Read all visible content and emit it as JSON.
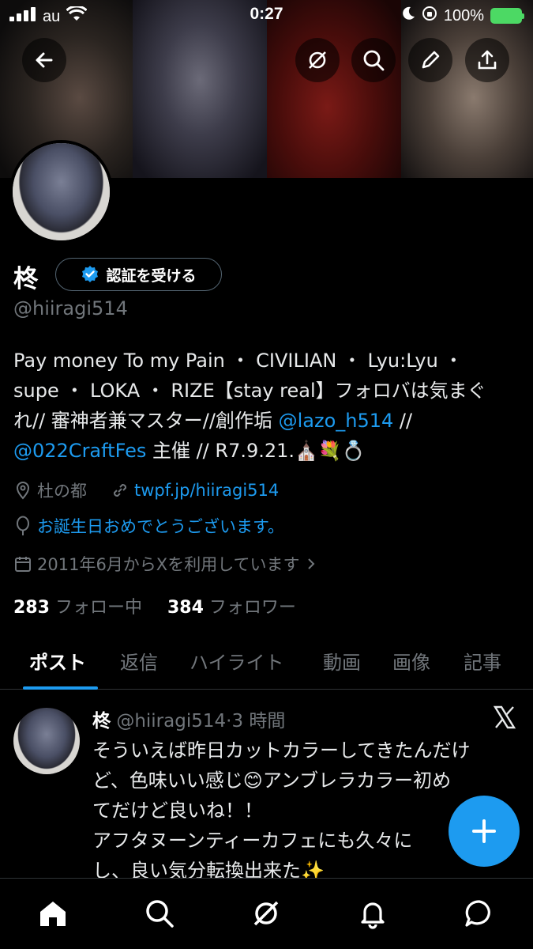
{
  "status_bar": {
    "carrier": "au",
    "time": "0:27",
    "battery": "100%"
  },
  "profile": {
    "name": "柊",
    "verify_label": "認証を受ける",
    "handle": "@hiiragi514",
    "bio": {
      "line1": "Pay money To my Pain ・ CIVILIAN ・ Lyu:Lyu ・",
      "line2": "supe ・ LOKA ・ RIZE【stay real】フォロバは気まぐ",
      "line3a": "れ// 審神者兼マスター//創作垢 ",
      "line3_link": "@lazo_h514",
      "line3b": " //",
      "line4_link": "@022CraftFes",
      "line4b": " 主催 // R7.9.21.⛪💐💍"
    },
    "location": "杜の都",
    "website": "twpf.jp/hiiragi514",
    "birthday": "お誕生日おめでとうございます。",
    "joined": "2011年6月からXを利用しています",
    "following_count": "283",
    "following_label": "フォロー中",
    "followers_count": "384",
    "followers_label": "フォロワー"
  },
  "tabs": [
    "ポスト",
    "返信",
    "ハイライト",
    "動画",
    "画像",
    "記事"
  ],
  "post": {
    "name": "柊",
    "handle": "@hiiragi514",
    "time": "3 時間",
    "line1": "そういえば昨日カットカラーしてきたんだけ",
    "line2": "ど、色味いい感じ😊アンブレラカラー初め",
    "line3": "てだけど良いね！！",
    "line4": "アフタヌーンティーカフェにも久々に",
    "line5": "し、良い気分転換出来た✨"
  },
  "colors": {
    "accent": "#1d9bf0",
    "text": "#e7e9ea",
    "muted": "#71767b",
    "bg": "#000000"
  }
}
